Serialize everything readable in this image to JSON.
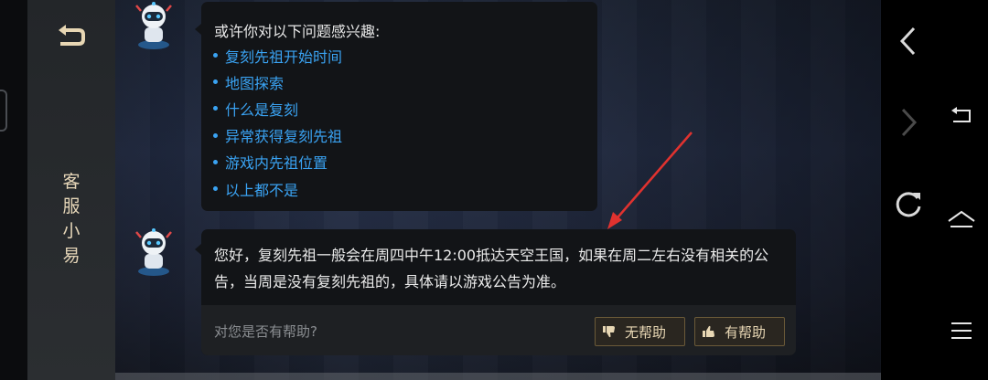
{
  "sidebar": {
    "title_chars": [
      "客",
      "服",
      "小",
      "易"
    ]
  },
  "chat": {
    "intro": "或许你对以下问题感兴趣:",
    "suggestions": [
      {
        "label": "复刻先祖开始时间"
      },
      {
        "label": "地图探索"
      },
      {
        "label": "什么是复刻"
      },
      {
        "label": "异常获得复刻先祖"
      },
      {
        "label": "游戏内先祖位置"
      },
      {
        "label": "以上都不是"
      }
    ],
    "answer": "您好，复刻先祖一般会在周四中午12:00抵达天空王国，如果在周二左右没有相关的公告，当周是没有复刻先祖的，具体请以游戏公告为准。",
    "feedback": {
      "question": "对您是否有帮助?",
      "not_helpful": "无帮助",
      "helpful": "有帮助"
    }
  },
  "colors": {
    "link": "#3aa3f3",
    "accent_gold": "#e8d7b4",
    "annotation": "#e0322f"
  },
  "icons": [
    "return-icon",
    "robot-avatar-icon",
    "thumbs-down-icon",
    "thumbs-up-icon",
    "browser-back-icon",
    "browser-forward-icon",
    "reload-icon",
    "system-back-icon",
    "home-icon",
    "menu-icon"
  ]
}
